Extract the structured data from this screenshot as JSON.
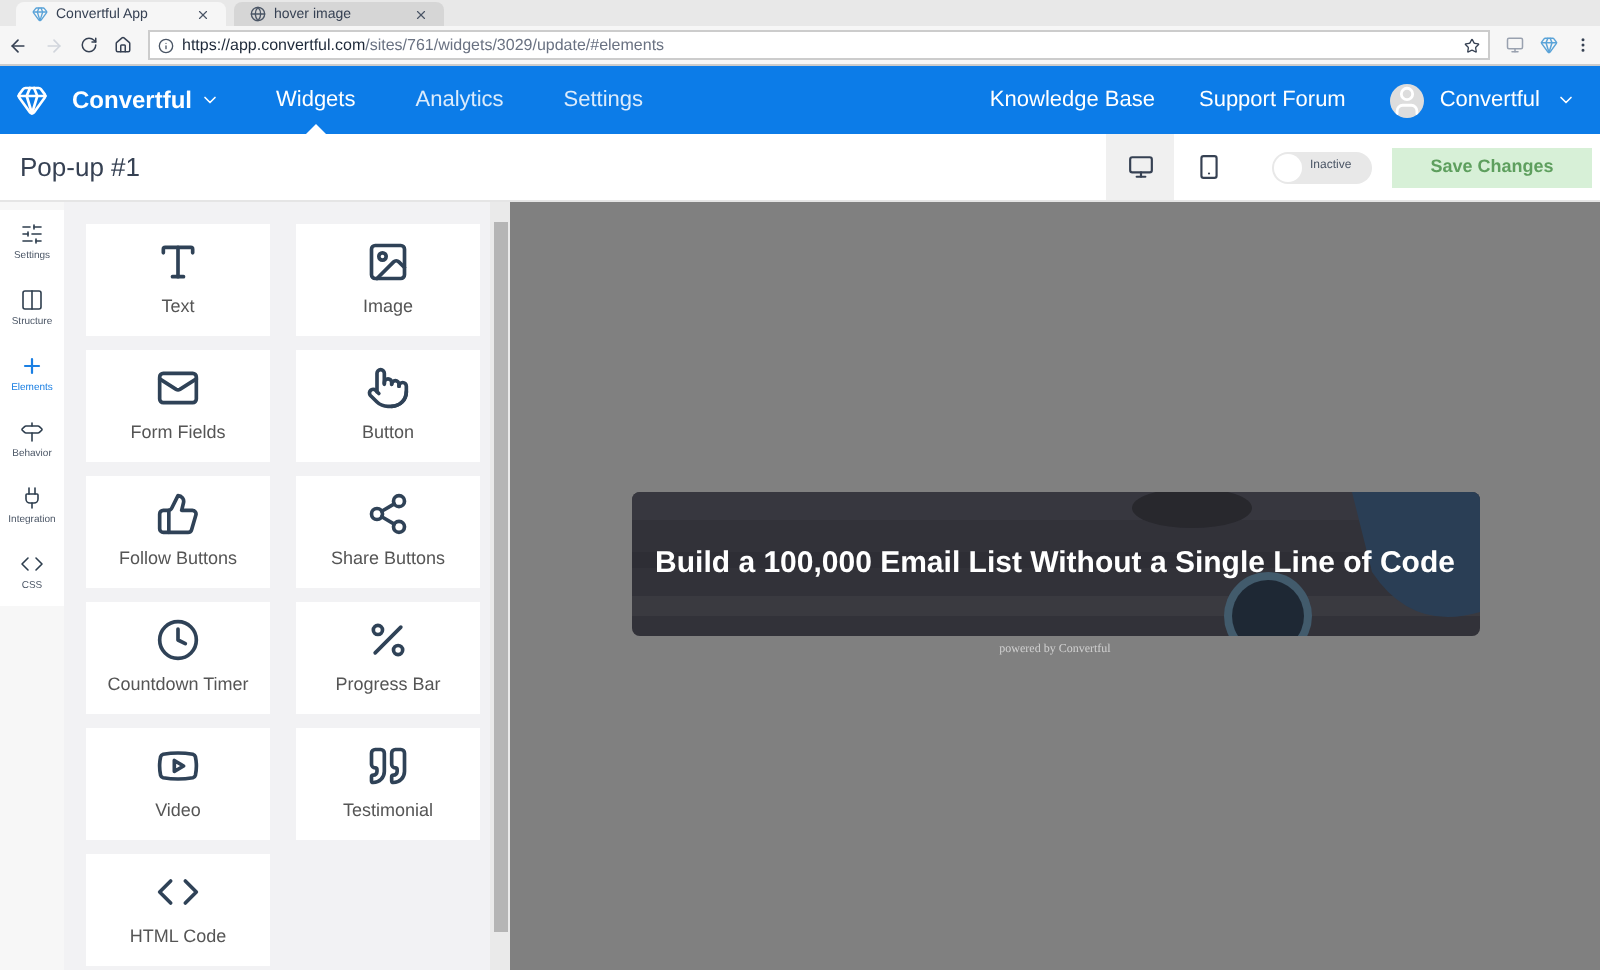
{
  "browser": {
    "tabs": [
      {
        "title": "Convertful App",
        "selected": true
      },
      {
        "title": "hover image",
        "selected": false
      }
    ],
    "url": {
      "host": "https://app.convertful.com",
      "path": "/sites/761/widgets/3029/update/#elements"
    }
  },
  "nav": {
    "brand": "Convertful",
    "items": [
      {
        "label": "Widgets",
        "selected": true
      },
      {
        "label": "Analytics",
        "selected": false
      },
      {
        "label": "Settings",
        "selected": false
      }
    ],
    "links": [
      "Knowledge Base",
      "Support Forum"
    ],
    "account": "Convertful"
  },
  "toolbar": {
    "title": "Pop-up #1",
    "devices": [
      {
        "selected": true
      },
      {
        "selected": false
      }
    ],
    "toggle": {
      "label": "Inactive",
      "on": false
    },
    "save": {
      "label": "Save Changes",
      "disabled": true
    }
  },
  "rail": [
    {
      "label": "Settings",
      "selected": false
    },
    {
      "label": "Structure",
      "selected": false
    },
    {
      "label": "Elements",
      "selected": true
    },
    {
      "label": "Behavior",
      "selected": false
    },
    {
      "label": "Integration",
      "selected": false
    },
    {
      "label": "CSS",
      "selected": false
    }
  ],
  "elements": [
    {
      "label": "Text"
    },
    {
      "label": "Image"
    },
    {
      "label": "Form Fields"
    },
    {
      "label": "Button"
    },
    {
      "label": "Follow Buttons"
    },
    {
      "label": "Share Buttons"
    },
    {
      "label": "Countdown Timer"
    },
    {
      "label": "Progress Bar"
    },
    {
      "label": "Video"
    },
    {
      "label": "Testimonial"
    },
    {
      "label": "HTML Code"
    }
  ],
  "canvas": {
    "banner": {
      "kind": "picture",
      "headline": "Build a 100,000 Email List Without a Single Line of Code"
    },
    "credit": "powered by Convertful"
  }
}
